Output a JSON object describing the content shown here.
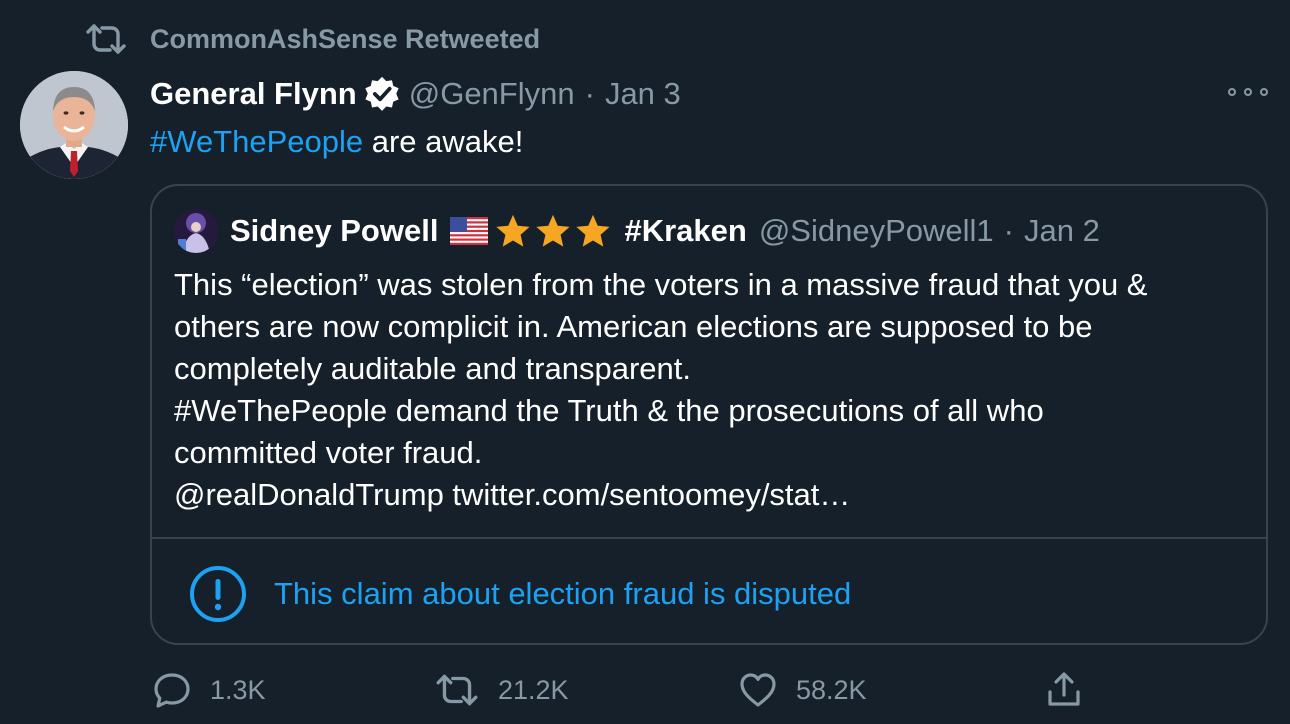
{
  "retweet": {
    "label": "CommonAshSense Retweeted",
    "icon": "retweet-icon"
  },
  "tweet": {
    "author_name": "General Flynn",
    "verified": true,
    "handle": "@GenFlynn",
    "separator": "·",
    "date": "Jan 3",
    "text_hashtag": "#WeThePeople",
    "text_rest": " are awake!",
    "more_icon": "more-icon"
  },
  "quote": {
    "author_name": "Sidney Powell",
    "flag_icon": "us-flag-icon",
    "star_icons": [
      "star-icon",
      "star-icon",
      "star-icon"
    ],
    "name_suffix": "#Kraken",
    "handle": "@SidneyPowell1",
    "separator": "·",
    "date": "Jan 2",
    "lines": [
      "This “election” was stolen from the voters in a massive fraud that you &",
      "others are now complicit in. American elections are supposed to be",
      "completely auditable and transparent.",
      "#WeThePeople demand the Truth & the prosecutions of all who",
      "committed voter fraud.",
      "@realDonaldTrump twitter.com/sentoomey/stat…"
    ]
  },
  "notice": {
    "text": "This claim about election fraud is disputed",
    "icon": "exclamation-circle-icon"
  },
  "actions": {
    "reply_count": "1.3K",
    "retweet_count": "21.2K",
    "like_count": "58.2K"
  },
  "colors": {
    "background": "#15202b",
    "accent": "#1da1f2",
    "secondary_text": "#8899a6",
    "border": "#38444d",
    "star": "#f5a623"
  }
}
